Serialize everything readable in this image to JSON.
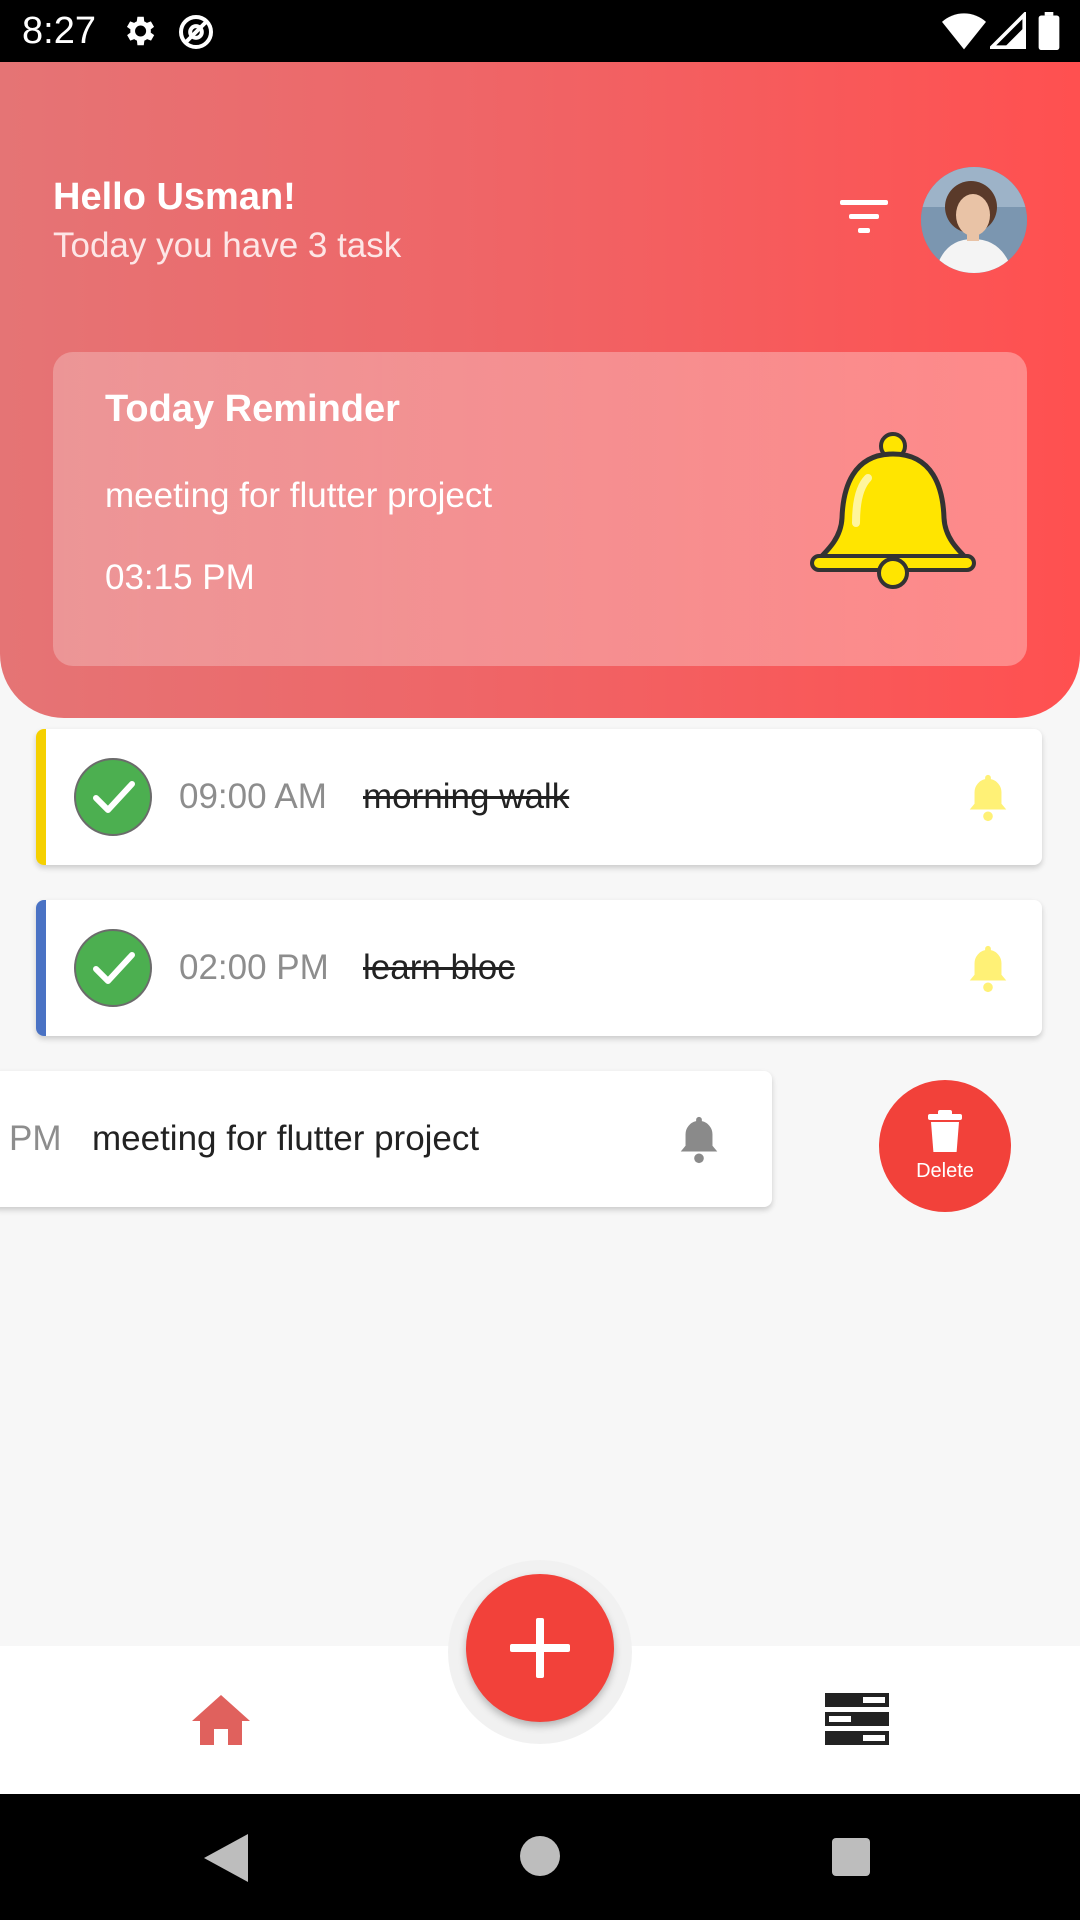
{
  "status_bar": {
    "time": "8:27",
    "icons": [
      "gear-icon",
      "at-sign-icon",
      "wifi-icon",
      "signal-icon",
      "battery-icon"
    ]
  },
  "header": {
    "greeting": "Hello Usman!",
    "subtitle": "Today you have 3 task",
    "filter_icon": "filter-icon",
    "avatar_icon": "user-avatar"
  },
  "reminder": {
    "title": "Today Reminder",
    "text": "meeting for flutter project",
    "time": "03:15 PM",
    "icon": "bell-icon",
    "bell_color": "#ffe500"
  },
  "tasks": [
    {
      "time": "09:00 AM",
      "title": "morning walk",
      "completed": true,
      "stripe_color": "#f5d000",
      "bell_color": "#fff176"
    },
    {
      "time": "02:00 PM",
      "title": "learn bloc",
      "completed": true,
      "stripe_color": "#4a72c4",
      "bell_color": "#fff176"
    },
    {
      "time": "PM",
      "title": "meeting for flutter project",
      "completed": false,
      "bell_color": "#8a8a8a"
    }
  ],
  "swipe_action": {
    "label": "Delete",
    "icon": "trash-icon",
    "color": "#f2413a"
  },
  "bottom_nav": {
    "fab_icon": "plus-icon",
    "home_icon": "home-icon",
    "tasks_icon": "list-icon",
    "accent": "#e0615d"
  },
  "system_nav": {
    "icons": [
      "back-icon",
      "home-circle-icon",
      "recents-icon"
    ]
  }
}
